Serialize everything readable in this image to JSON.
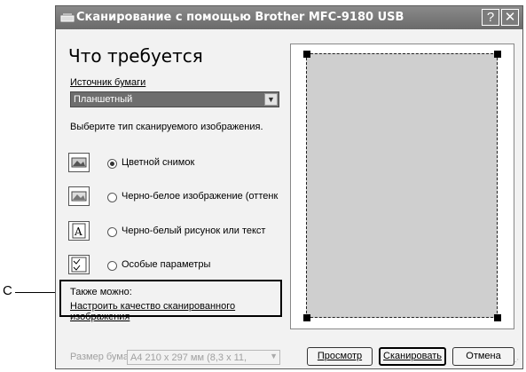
{
  "callout": {
    "letter": "C"
  },
  "window": {
    "title": "Сканирование с помощью Brother MFC-9180 USB",
    "help_btn": "?",
    "close_btn": "✕"
  },
  "main": {
    "heading": "Что требуется",
    "source_label": "Источник бумаги",
    "source_value": "Планшетный",
    "type_prompt": "Выберите тип сканируемого изображения.",
    "options": [
      {
        "label": "Цветной снимок",
        "selected": true,
        "icon": "color-photo-icon"
      },
      {
        "label": "Черно-белое изображение (оттенк",
        "selected": false,
        "icon": "grayscale-photo-icon"
      },
      {
        "label": "Черно-белый рисунок или текст",
        "selected": false,
        "icon": "bw-text-icon"
      },
      {
        "label": "Особые параметры",
        "selected": false,
        "icon": "custom-settings-icon"
      }
    ],
    "also_label": "Также можно:",
    "adjust_link_line1": "Настроить качество сканированного",
    "adjust_link_line2": "изображения"
  },
  "footer": {
    "size_label": "Размер бумаги:",
    "size_value": "A4 210 x 297 мм (8,3 x 11,",
    "preview_btn": "Просмотр",
    "scan_btn": "Сканировать",
    "cancel_btn": "Отмена"
  },
  "colors": {
    "titlebar": "#7a7a7a",
    "scan_area": "#cfcfcf",
    "window_bg": "#f2f2f2"
  }
}
